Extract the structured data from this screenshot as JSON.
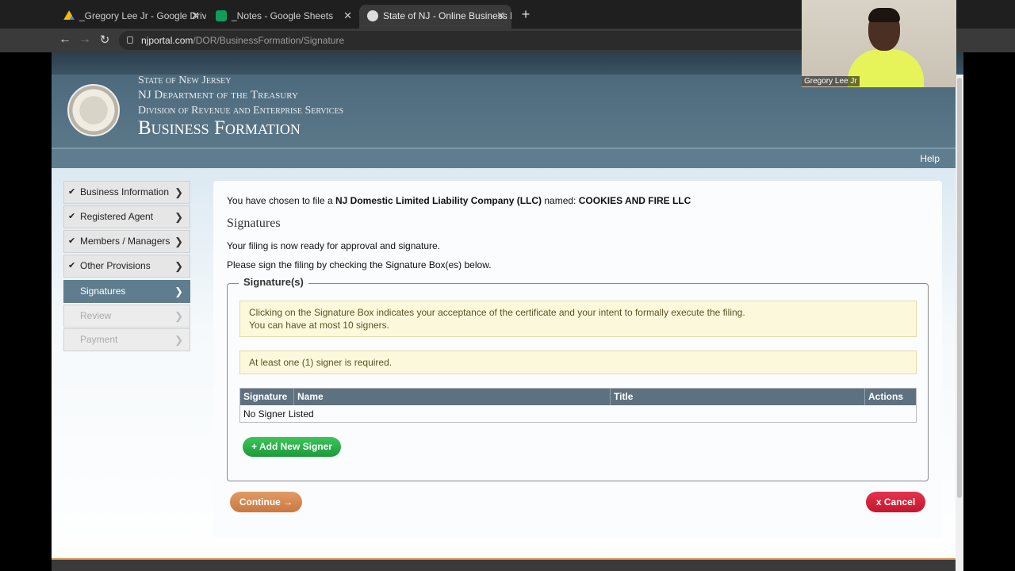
{
  "browser": {
    "tabs": [
      {
        "title": "_Gregory Lee Jr - Google Drive",
        "icon": "google-drive-icon"
      },
      {
        "title": "_Notes - Google Sheets",
        "icon": "google-sheets-icon"
      },
      {
        "title": "State of NJ - Online Business Formation",
        "icon": "nj-portal-icon"
      }
    ],
    "new_tab": "+",
    "url_host": "njportal.com",
    "url_path": "/DOR/BusinessFormation/Signature"
  },
  "header": {
    "line1": "State of New Jersey",
    "line2": "NJ Department of the Treasury",
    "line3": "Division of Revenue and Enterprise Services",
    "title": "Business Formation",
    "help": "Help"
  },
  "sidebar": {
    "items": [
      {
        "label": "Business Information",
        "state": "done"
      },
      {
        "label": "Registered Agent",
        "state": "done"
      },
      {
        "label": "Members / Managers",
        "state": "done"
      },
      {
        "label": "Other Provisions",
        "state": "done"
      },
      {
        "label": "Signatures",
        "state": "current"
      },
      {
        "label": "Review",
        "state": "disabled"
      },
      {
        "label": "Payment",
        "state": "disabled"
      }
    ]
  },
  "main": {
    "chosen_prefix": "You have chosen to file a ",
    "entity_type": "NJ Domestic Limited Liability Company (LLC)",
    "chosen_mid": " named: ",
    "entity_name": "COOKIES AND FIRE LLC",
    "section_title": "Signatures",
    "ready_text": "Your filing is now ready for approval and signature.",
    "instruction": "Please sign the filing by checking the Signature Box(es) below.",
    "fieldset_legend": "Signature(s)",
    "note1_line1": "Clicking on the Signature Box indicates your acceptance of the certificate and your intent to formally execute the filing.",
    "note1_line2": "You can have at most 10 signers.",
    "note2": "At least one (1) signer is required.",
    "table": {
      "headers": [
        "Signature",
        "Name",
        "Title",
        "Actions"
      ],
      "empty_text": "No Signer Listed"
    },
    "add_signer": "+ Add New Signer",
    "continue": "Continue →",
    "cancel": "x Cancel"
  },
  "webcam": {
    "name": "Gregory Lee Jr"
  },
  "colors": {
    "header_blue": "#4d6a7d",
    "green_button": "#1e9a3b",
    "orange_button": "#c9783f",
    "red_button": "#c4162e"
  }
}
